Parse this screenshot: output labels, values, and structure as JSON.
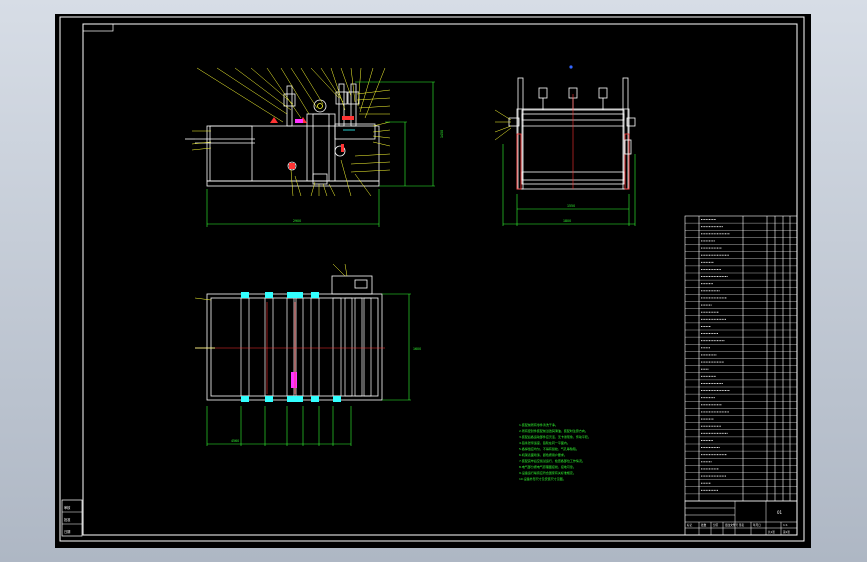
{
  "title_block": {
    "drawing_no": "01",
    "scale": "1:1",
    "sheet": "第1张",
    "sheets_total": "共1张",
    "row_labels": [
      "标记",
      "处数",
      "分区",
      "更改文件号",
      "签名",
      "年月日"
    ]
  },
  "side_stamp": {
    "cells": [
      "审核",
      "批准",
      "日期"
    ]
  },
  "technical_notes": [
    "1.装配前所有零件清洗干净。",
    "2.所有密封件装配前浸透润滑油，装配时注意方向。",
    "3.装配后各运动部件应灵活，无卡滞现象，传动平稳。",
    "4.链条张紧适度，链轮在同一平面内。",
    "5.各焊缝应均匀，不得有裂纹、气孔等缺陷。",
    "6.机架表面喷漆，颜色按用户要求。",
    "7.装配完毕后空载试运行，检查各部位工作情况。",
    "8.电气部分按电气原理图接线，接地可靠。",
    "9.设备运行噪音应符合国家有关标准规定。",
    "10.设备外形尺寸及安装尺寸见图。"
  ],
  "dimensions": {
    "front_width": "2900",
    "front_height": "1450",
    "side_width": "1550",
    "side_overall": "1800",
    "top_length": "4560",
    "top_depth": "1600"
  },
  "colors": {
    "outline": "#ffffff",
    "dimension": "#33ff33",
    "centerline": "#ff3333",
    "highlight": "#ff33ff",
    "leader": "#ffff33",
    "cyan": "#33ffff"
  }
}
